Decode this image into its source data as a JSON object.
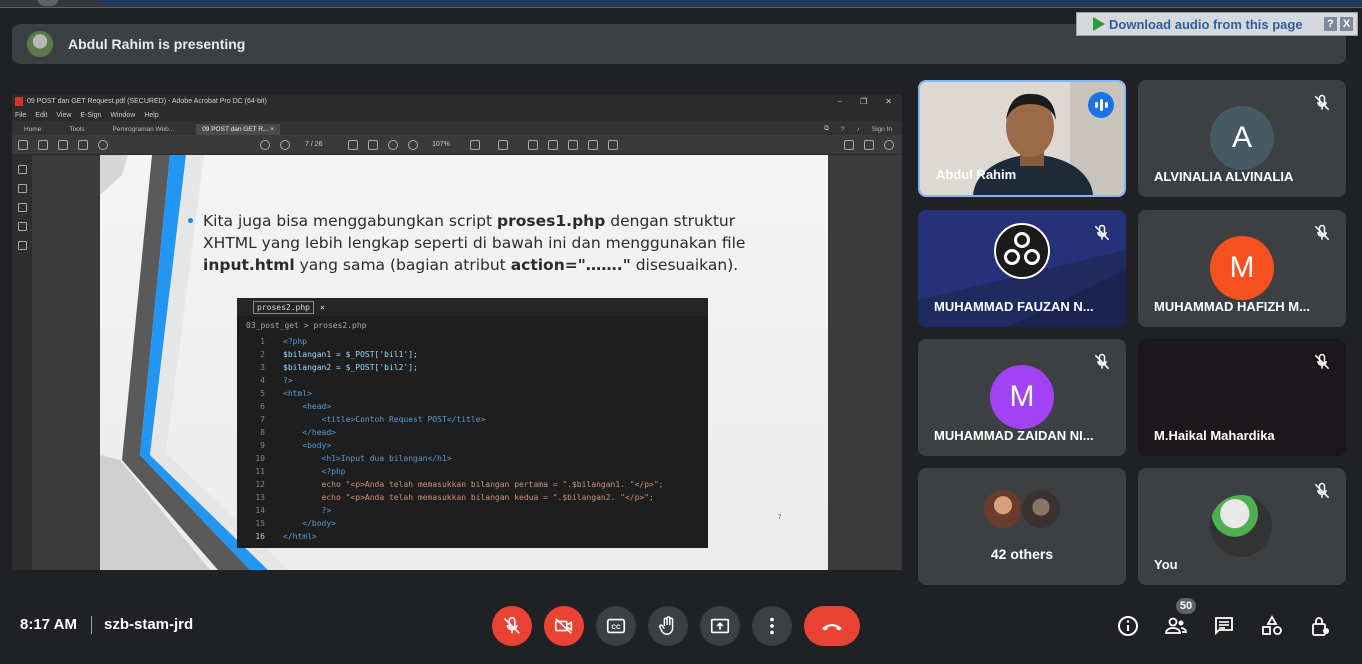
{
  "banner": {
    "presenting_text": "Abdul Rahim is presenting"
  },
  "extension": {
    "label": "Download audio from this page",
    "help": "?",
    "close": "X"
  },
  "acrobat": {
    "window_title": "09 POST dan GET Request.pdf (SECURED) - Adobe Acrobat Pro DC (64-bit)",
    "menu": [
      "File",
      "Edit",
      "View",
      "E-Sign",
      "Window",
      "Help"
    ],
    "tabs": [
      "Home",
      "Tools",
      "Pemrograman Web...",
      "09 POST dan GET R..."
    ],
    "sign_in": "Sign In",
    "page_current": "7",
    "page_total": "/ 26",
    "zoom": "107%"
  },
  "slide": {
    "text_part1": "Kita juga bisa menggabungkan script ",
    "bold1": "proses1.php",
    "text_part2": " dengan struktur XHTML yang lebih lengkap seperti di bawah ini dan menggunakan file ",
    "bold2": "input.html",
    "text_part3": " yang sama (bagian atribut ",
    "bold3": "action=\"…….\"",
    "text_part4": " disesuaikan).",
    "page_number": "7"
  },
  "code": {
    "tab_file": "proses2.php",
    "tab_close": "×",
    "crumb_folder": "03_post_get",
    "crumb_sep": ">",
    "crumb_file": "proses2.php",
    "lines": [
      {
        "n": "1",
        "t": "<?php"
      },
      {
        "n": "2",
        "t": "$bilangan1 = $_POST['bil1'];"
      },
      {
        "n": "3",
        "t": "$bilangan2 = $_POST['bil2'];"
      },
      {
        "n": "4",
        "t": "?>"
      },
      {
        "n": "5",
        "t": "<html>"
      },
      {
        "n": "6",
        "t": "    <head>"
      },
      {
        "n": "7",
        "t": "        <title>Contoh Request POST</title>"
      },
      {
        "n": "8",
        "t": "    </head>"
      },
      {
        "n": "9",
        "t": "    <body>"
      },
      {
        "n": "10",
        "t": "        <h1>Input dua bilangan</h1>"
      },
      {
        "n": "11",
        "t": "        <?php"
      },
      {
        "n": "12",
        "t": "        echo \"<p>Anda telah memasukkan bilangan pertama = \".$bilangan1. \"</p>\";"
      },
      {
        "n": "13",
        "t": "        echo \"<p>Anda telah memasukkan bilangan kedua = \".$bilangan2. \"</p>\";"
      },
      {
        "n": "14",
        "t": "        ?>"
      },
      {
        "n": "15",
        "t": "    </body>"
      },
      {
        "n": "16",
        "t": "</html>"
      }
    ]
  },
  "participants": [
    {
      "name": "Abdul Rahim",
      "type": "video",
      "speaking": true
    },
    {
      "name": "ALVINALIA ALVINALIA",
      "initial": "A",
      "color": "#455a64",
      "muted": true
    },
    {
      "name": "MUHAMMAD FAUZAN N...",
      "type": "obs",
      "muted": true
    },
    {
      "name": "MUHAMMAD HAFIZH M...",
      "initial": "M",
      "color": "#f4511e",
      "muted": true
    },
    {
      "name": "MUHAMMAD ZAIDAN NI...",
      "initial": "M",
      "color": "#a142f4",
      "muted": true
    },
    {
      "name": "M.Haikal Mahardika",
      "type": "dark",
      "muted": true
    },
    {
      "name": "42 others",
      "type": "others"
    },
    {
      "name": "You",
      "type": "self",
      "muted": true
    }
  ],
  "bottom": {
    "time": "8:17 AM",
    "meeting_code": "szb-stam-jrd",
    "people_count": "50"
  },
  "colors": {
    "accent": "#1a73e8",
    "danger": "#ea4335",
    "bg": "#202124",
    "tile": "#3c4043"
  }
}
